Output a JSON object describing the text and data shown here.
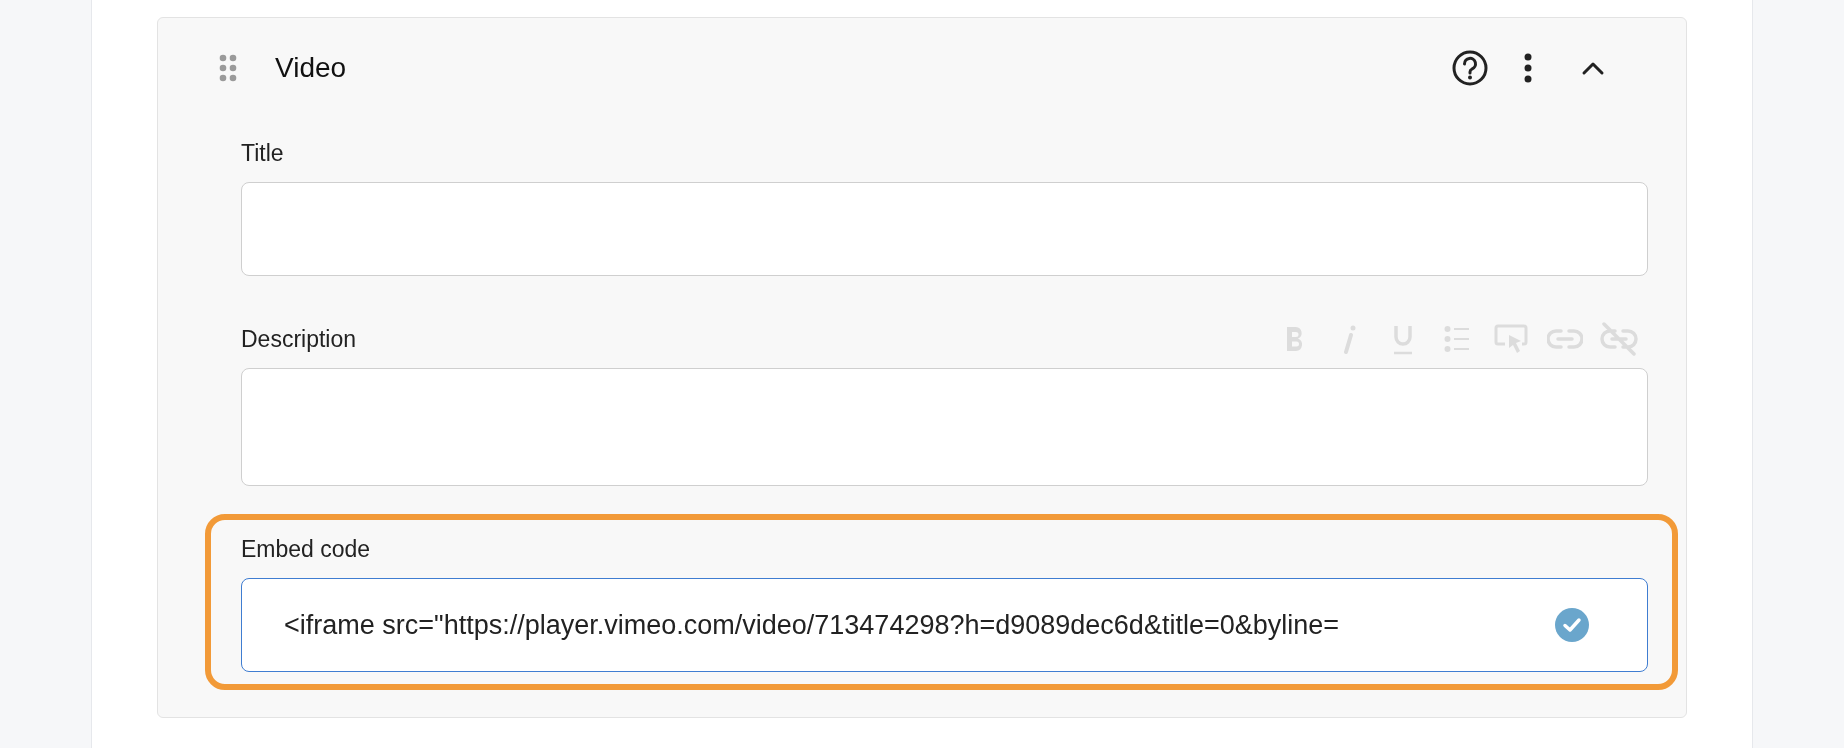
{
  "block": {
    "title": "Video",
    "expanded": true,
    "fields": [
      {
        "kind": "text",
        "label": "Title",
        "highlighted": false
      },
      {
        "kind": "rich",
        "label": "Description",
        "highlighted": false,
        "toolbar": [
          {
            "kind": "bold",
            "disabled": true
          },
          {
            "kind": "italic",
            "disabled": true
          },
          {
            "kind": "underline",
            "disabled": true
          },
          {
            "kind": "list",
            "disabled": true
          },
          {
            "kind": "button",
            "disabled": true
          },
          {
            "kind": "link",
            "disabled": true
          },
          {
            "kind": "unlink",
            "disabled": true
          }
        ]
      },
      {
        "kind": "text",
        "label": "Embed code",
        "value": "<iframe src=\"https://player.vimeo.com/video/713474298?h=d9089dec6d&title=0&byline=",
        "valid": true,
        "highlighted": true
      }
    ]
  }
}
